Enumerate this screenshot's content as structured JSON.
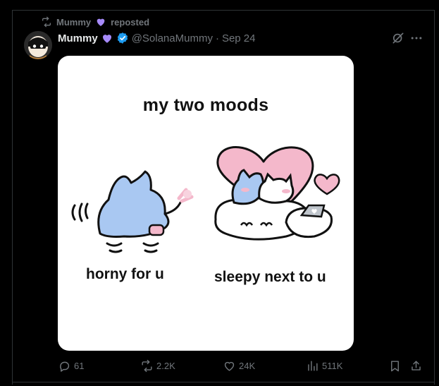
{
  "repost": {
    "user": "Mummy",
    "action": "reposted"
  },
  "tweet": {
    "display_name": "Mummy",
    "handle": "@SolanaMummy",
    "separator": "·",
    "date": "Sep 24"
  },
  "media": {
    "title": "my two moods",
    "caption_left": "horny for u",
    "caption_right": "sleepy next to u"
  },
  "actions": {
    "replies": "61",
    "reposts": "2.2K",
    "likes": "24K",
    "views": "511K"
  },
  "colors": {
    "accent_blue": "#1d9bf0",
    "purple_heart": "#a78bfa",
    "muted": "#71767b",
    "cat_blue": "#a9c8f2",
    "heart_pink": "#f4b8cb"
  },
  "icons": [
    "retweet-icon",
    "purple-heart-icon",
    "verified-icon",
    "grok-icon",
    "more-icon",
    "reply-icon",
    "like-icon",
    "views-icon",
    "bookmark-icon",
    "share-icon"
  ]
}
